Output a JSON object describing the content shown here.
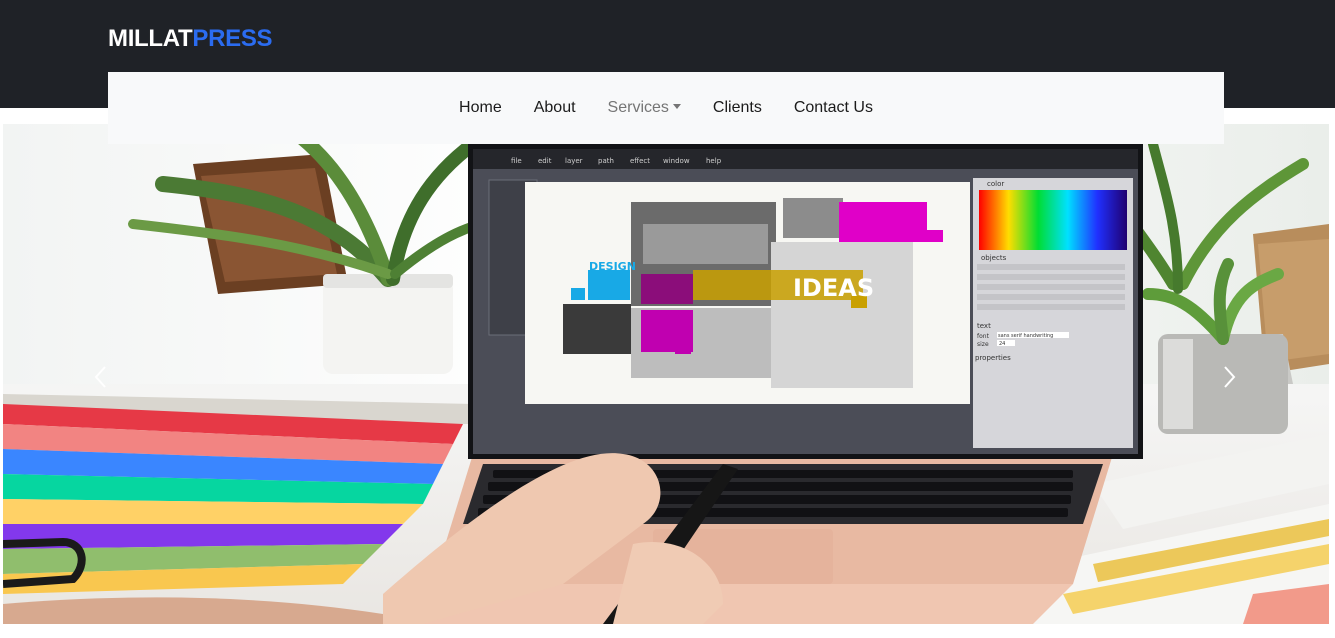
{
  "brand": {
    "part1": "MILLAT",
    "part2": "PRESS"
  },
  "nav": {
    "home": "Home",
    "about": "About",
    "services": "Services",
    "clients": "Clients",
    "contact": "Contact Us"
  },
  "hero": {
    "screen_menu": [
      "file",
      "edit",
      "layer",
      "path",
      "effect",
      "window",
      "help"
    ],
    "design_label": "DESIGN",
    "ideas_label": "IDEAS",
    "panel_color": "color",
    "panel_objects": "objects",
    "panel_text": "text",
    "panel_properties": "properties",
    "font_label": "font",
    "font_value": "sans serif handwriting",
    "size_label": "size",
    "size_value": "24"
  },
  "colors": {
    "topbar": "#1f2227",
    "brand_accent": "#2b6cf0",
    "nav_bg": "#f8f9fa"
  },
  "icons": {
    "prev": "chevron-left-icon",
    "next": "chevron-right-icon",
    "services_caret": "caret-down-icon"
  }
}
